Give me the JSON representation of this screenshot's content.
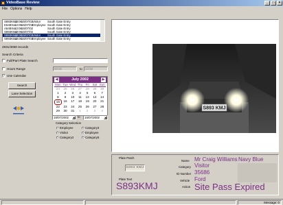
{
  "window": {
    "title": "VideoBase Review"
  },
  "menu": [
    "File",
    "Options",
    "Help"
  ],
  "records_list": {
    "rows": [
      [
        "S893KMJ",
        "10:06",
        "15/07/02",
        "Visitor",
        "South Gate Entry"
      ],
      [
        "K648XvL",
        "10:06",
        "15/07/02",
        "Employee",
        "South Gate Entry"
      ],
      [
        "A648XvL",
        "10:06",
        "15/07/02",
        "",
        "South Gate Entry"
      ],
      [
        "S893KMJ",
        "10:06",
        "15/07/02",
        "",
        "South Gate Entry"
      ],
      [
        "S893KMJ",
        "10:06",
        "15/07/02",
        "Visitor",
        "South Gate Entry"
      ],
      [
        "S893KMJ",
        "10:06",
        "15/07/02",
        "Employee",
        "South Gate Entry"
      ]
    ],
    "selected_index": 4
  },
  "records_count": "2931/3069 records",
  "search": {
    "criteria_label": "Search Criteria",
    "plate_label": "Full/Part Plate Search",
    "hours_label": "Hours Range",
    "hours_from": "00:00",
    "hours_to_label": "to",
    "hours_to": "23:59",
    "calendar_label": "Use Calendar",
    "search_button": "Search",
    "lane_button": "Lane Selection"
  },
  "calendar": {
    "month": "July 2002",
    "dow": [
      "Mon",
      "Tue",
      "Wed",
      "Thu",
      "Fri",
      "Sat",
      "Sun"
    ],
    "weeks": [
      [
        "24",
        "25",
        "26",
        "27",
        "28",
        "29",
        "30"
      ],
      [
        "1",
        "2",
        "3",
        "4",
        "5",
        "6",
        "7"
      ],
      [
        "8",
        "9",
        "10",
        "11",
        "12",
        "13",
        "14"
      ],
      [
        "15",
        "16",
        "17",
        "18",
        "19",
        "20",
        "21"
      ],
      [
        "22",
        "23",
        "24",
        "25",
        "26",
        "27",
        "28"
      ],
      [
        "29",
        "30",
        "31",
        "1",
        "2",
        "3",
        "4"
      ]
    ],
    "today": "15"
  },
  "date_range": {
    "from": "15/07/2002",
    "to_label": "to",
    "to": "15/07/2002"
  },
  "category": {
    "legend": "Category Selection",
    "left": [
      "Employee",
      "Visitor",
      "Category2"
    ],
    "right": [
      "Category3",
      "Employee",
      "Category5"
    ]
  },
  "details": {
    "plate_patch_label": "Plate Patch",
    "plate_text_label": "Plate Text",
    "plate_text": "S893KMJ",
    "plate_patch_text": "S893 KMJ",
    "name_label": "Name",
    "name": "Mr Craig Williams",
    "color": "Navy Blue",
    "category_label": "Category",
    "category": "Visitor",
    "id_label": "ID Number",
    "id": "35686",
    "vehicle_label": "Vehicle",
    "vehicle": "Ford",
    "action_label": "Action",
    "action": "Site Pass Expired"
  },
  "photo_plate": "S893 KMJ",
  "status": {
    "right": "Message: 0"
  },
  "colors": {
    "accent": "#7b2f84",
    "title": "#0a246a"
  }
}
